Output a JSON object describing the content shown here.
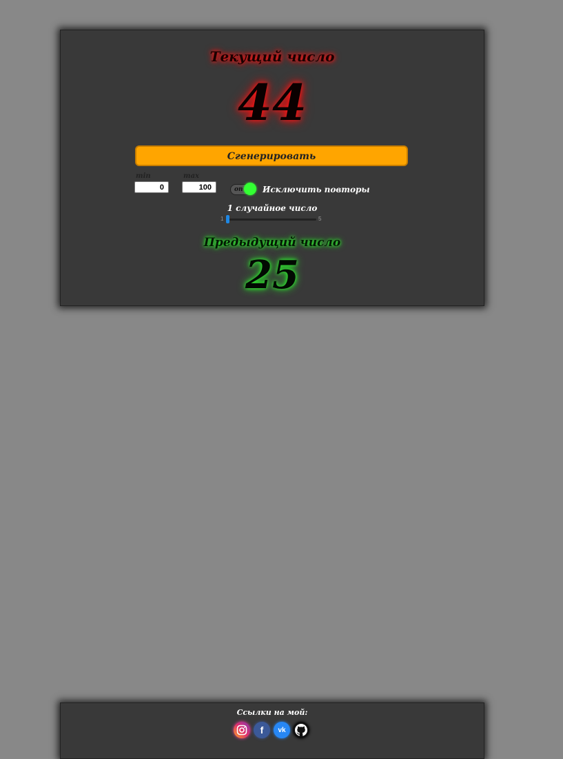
{
  "generator": {
    "current_title": "Текущий число",
    "current_value": "44",
    "generate_label": "Сгенерировать",
    "min_label": "min",
    "min_value": "0",
    "max_label": "max",
    "max_value": "100",
    "toggle_text": "on",
    "exclude_label": "Исключить повторы",
    "count_label": "1 случайное число",
    "count_range_min": "1",
    "count_range_max": "5",
    "count_value": 1,
    "previous_title": "Предыдущий число",
    "previous_value": "25"
  },
  "footer": {
    "links_title": "Ссылки на мой:",
    "icons": [
      "instagram-icon",
      "facebook-icon",
      "vk-icon",
      "github-icon"
    ],
    "fb_glyph": "f",
    "vk_glyph": "vk"
  },
  "colors": {
    "background": "#888888",
    "panel": "#393939",
    "button": "#ffa500",
    "current_glow": "#ff0000",
    "previous_glow": "#33ff33",
    "toggle_on": "#33ff33",
    "slider_thumb": "#1e88e5"
  }
}
